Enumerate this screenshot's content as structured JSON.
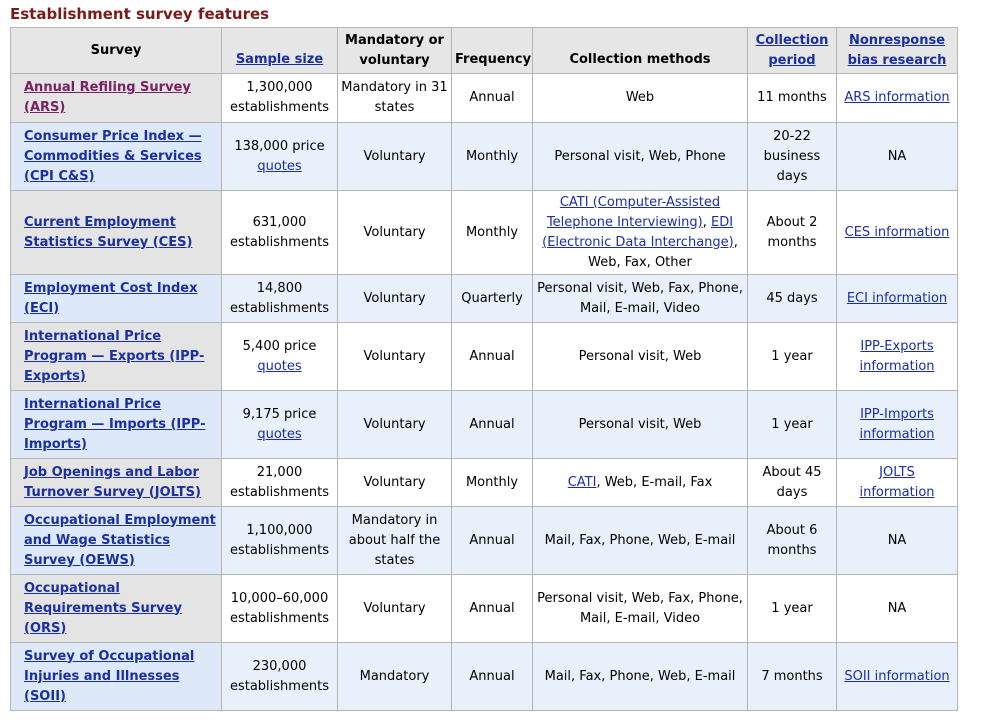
{
  "caption": "Establishment survey features",
  "headers": {
    "survey": "Survey",
    "sample_size": "Sample size",
    "mandatory": "Mandatory or voluntary",
    "frequency": "Frequency",
    "collection_methods": "Collection methods",
    "collection_period": "Collection period",
    "nonresponse": "Nonresponse bias research"
  },
  "rows": [
    {
      "name": "Annual Refiling Survey (ARS)",
      "sample": "1,300,000 establishments",
      "mandatory": "Mandatory in 31 states",
      "frequency": "Annual",
      "methods": "Web",
      "period": "11 months",
      "bias": "ARS information"
    },
    {
      "name": "Consumer Price Index — Commodities & Services (CPI C&S)",
      "sample_prefix": "138,000 price",
      "sample_link": "quotes",
      "mandatory": "Voluntary",
      "frequency": "Monthly",
      "methods": "Personal visit, Web, Phone",
      "period": "20-22 business days",
      "bias": "NA"
    },
    {
      "name": "Current Employment Statistics Survey (CES)",
      "sample": "631,000 establishments",
      "mandatory": "Voluntary",
      "frequency": "Monthly",
      "methods_link1": "CATI (Computer-Assisted Telephone Interviewing)",
      "methods_sep": ", ",
      "methods_link2": "EDI (Electronic Data Interchange)",
      "methods_rest": ", Web, Fax, Other",
      "period": "About 2 months",
      "bias": "CES information"
    },
    {
      "name": "Employment Cost Index (ECI)",
      "sample": "14,800 establishments",
      "mandatory": "Voluntary",
      "frequency": "Quarterly",
      "methods": "Personal visit, Web, Fax, Phone, Mail, E-mail, Video",
      "period": "45 days",
      "bias": "ECI information"
    },
    {
      "name": "International Price Program — Exports (IPP-Exports)",
      "sample_prefix": "5,400 price",
      "sample_link": "quotes",
      "mandatory": "Voluntary",
      "frequency": "Annual",
      "methods": "Personal visit, Web",
      "period": "1 year",
      "bias": "IPP-Exports information"
    },
    {
      "name": "International Price Program — Imports (IPP-Imports)",
      "sample_prefix": "9,175 price",
      "sample_link": "quotes",
      "mandatory": "Voluntary",
      "frequency": "Annual",
      "methods": "Personal visit, Web",
      "period": "1 year",
      "bias": "IPP-Imports information"
    },
    {
      "name": "Job Openings and Labor Turnover Survey (JOLTS)",
      "sample": "21,000 establishments",
      "mandatory": "Voluntary",
      "frequency": "Monthly",
      "methods_link1": "CATI",
      "methods_rest": ", Web, E-mail, Fax",
      "period": "About 45 days",
      "bias": "JOLTS information"
    },
    {
      "name": "Occupational Employment and Wage Statistics Survey (OEWS)",
      "sample": "1,100,000 establishments",
      "mandatory": "Mandatory in about half the states",
      "frequency": "Annual",
      "methods": "Mail, Fax, Phone, Web, E-mail",
      "period": "About 6 months",
      "bias": "NA"
    },
    {
      "name": "Occupational Requirements Survey (ORS)",
      "sample": "10,000–60,000 establishments",
      "mandatory": "Voluntary",
      "frequency": "Annual",
      "methods": "Personal visit, Web, Fax, Phone, Mail, E-mail, Video",
      "period": "1 year",
      "bias": "NA"
    },
    {
      "name": "Survey of Occupational Injuries and Illnesses (SOII)",
      "sample": "230,000 establishments",
      "mandatory": "Mandatory",
      "frequency": "Annual",
      "methods": "Mail, Fax, Phone, Web, E-mail",
      "period": "7 months",
      "bias": "SOII information"
    }
  ]
}
